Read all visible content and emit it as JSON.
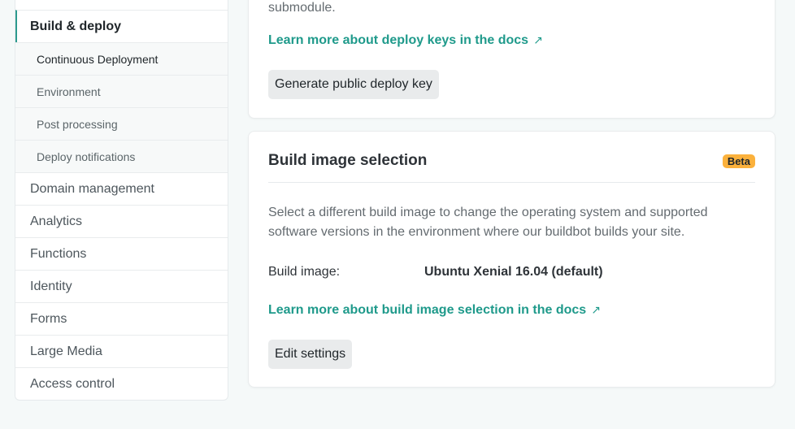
{
  "sidebar": {
    "active_section": "Build & deploy",
    "sub_items": [
      "Continuous Deployment",
      "Environment",
      "Post processing",
      "Deploy notifications"
    ],
    "sections": [
      "Domain management",
      "Analytics",
      "Functions",
      "Identity",
      "Forms",
      "Large Media",
      "Access control"
    ]
  },
  "deploy_keys_card": {
    "text_tail": "submodule.",
    "link": "Learn more about deploy keys in the docs",
    "link_icon": "external-arrow-icon",
    "button": "Generate public deploy key"
  },
  "build_image_card": {
    "title": "Build image selection",
    "badge": "Beta",
    "description": "Select a different build image to change the operating system and supported software versions in the environment where our buildbot builds your site.",
    "field_label": "Build image:",
    "field_value": "Ubuntu Xenial 16.04 (default)",
    "link": "Learn more about build image selection in the docs",
    "link_icon": "external-arrow-icon",
    "button": "Edit settings"
  },
  "colors": {
    "accent": "#1f9a8b",
    "badge": "#fbb13c",
    "background": "#f5f9f9"
  }
}
